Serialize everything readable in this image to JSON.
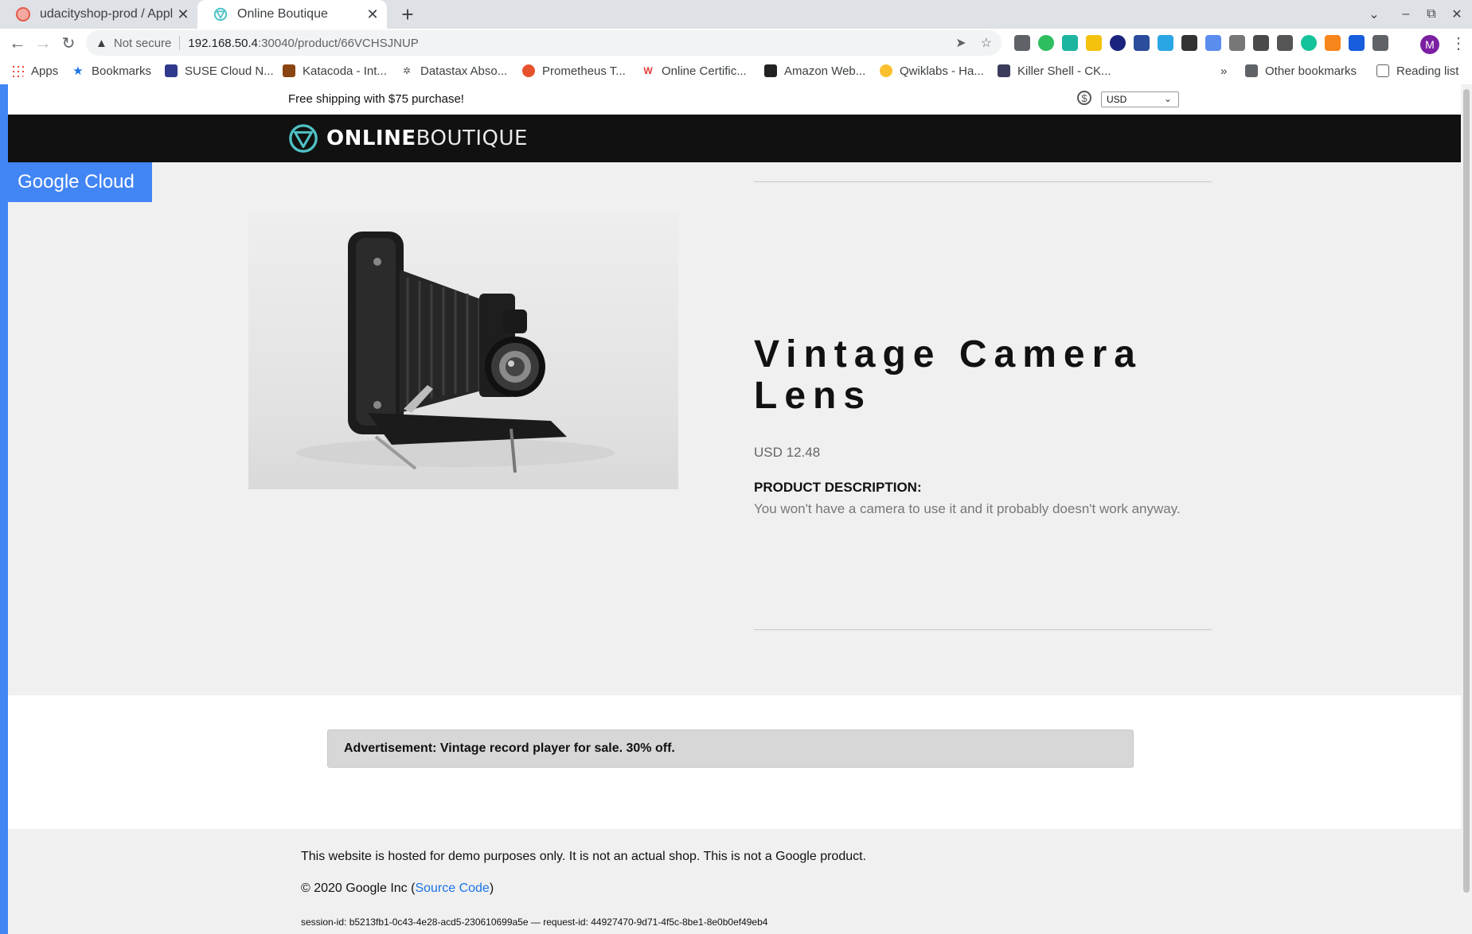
{
  "browser": {
    "tabs": [
      {
        "title": "udacityshop-prod / Applic",
        "active": false
      },
      {
        "title": "Online Boutique",
        "active": true
      }
    ],
    "new_tab_symbol": "+",
    "window_controls": {
      "list": "⌄",
      "minimize": "–",
      "restore": "⧉",
      "close": "✕"
    },
    "address": {
      "security_label": "Not secure",
      "host": "192.168.50.4",
      "path": ":30040/product/66VCHSJNUP"
    },
    "profile_initial": "M",
    "bookmarks": [
      {
        "label": "Apps",
        "icon": "apps-grid-icon"
      },
      {
        "label": "Bookmarks",
        "icon": "star-icon"
      },
      {
        "label": "SUSE Cloud N...",
        "icon": "suse-icon"
      },
      {
        "label": "Katacoda - Int...",
        "icon": "katacoda-icon"
      },
      {
        "label": "Datastax Abso...",
        "icon": "datastax-icon"
      },
      {
        "label": "Prometheus T...",
        "icon": "prometheus-icon"
      },
      {
        "label": "Online Certific...",
        "icon": "certification-icon"
      },
      {
        "label": "Amazon Web...",
        "icon": "aws-icon"
      },
      {
        "label": "Qwiklabs - Ha...",
        "icon": "qwiklabs-icon"
      },
      {
        "label": "Killer Shell - CK...",
        "icon": "killershell-icon"
      }
    ],
    "bookmarks_overflow": "»",
    "other_bookmarks": "Other bookmarks",
    "reading_list": "Reading list"
  },
  "site": {
    "shipping_banner": "Free shipping with $75 purchase!",
    "currency_symbol": "$",
    "currency": "USD",
    "logo": {
      "bold": "ONLINE",
      "light": "BOUTIQUE"
    },
    "brand_badge": "Google Cloud",
    "colors": {
      "accent": "#4285f4",
      "header": "#111111",
      "logo_teal": "#4fc3c6",
      "link": "#1a73e8"
    }
  },
  "product": {
    "title": "Vintage Camera Lens",
    "price": "USD 12.48",
    "description_label": "PRODUCT DESCRIPTION:",
    "description": "You won't have a camera to use it and it probably doesn't work anyway."
  },
  "ad": {
    "text": "Advertisement: Vintage record player for sale. 30% off."
  },
  "footer": {
    "disclaimer": "This website is hosted for demo purposes only. It is not an actual shop. This is not a Google product.",
    "copyright_prefix": "© 2020 Google Inc (",
    "source_link": "Source Code",
    "copyright_suffix": ")",
    "ids": "session-id: b5213fb1-0c43-4e28-acd5-230610699a5e — request-id: 44927470-9d71-4f5c-8be1-8e0b0ef49eb4"
  }
}
